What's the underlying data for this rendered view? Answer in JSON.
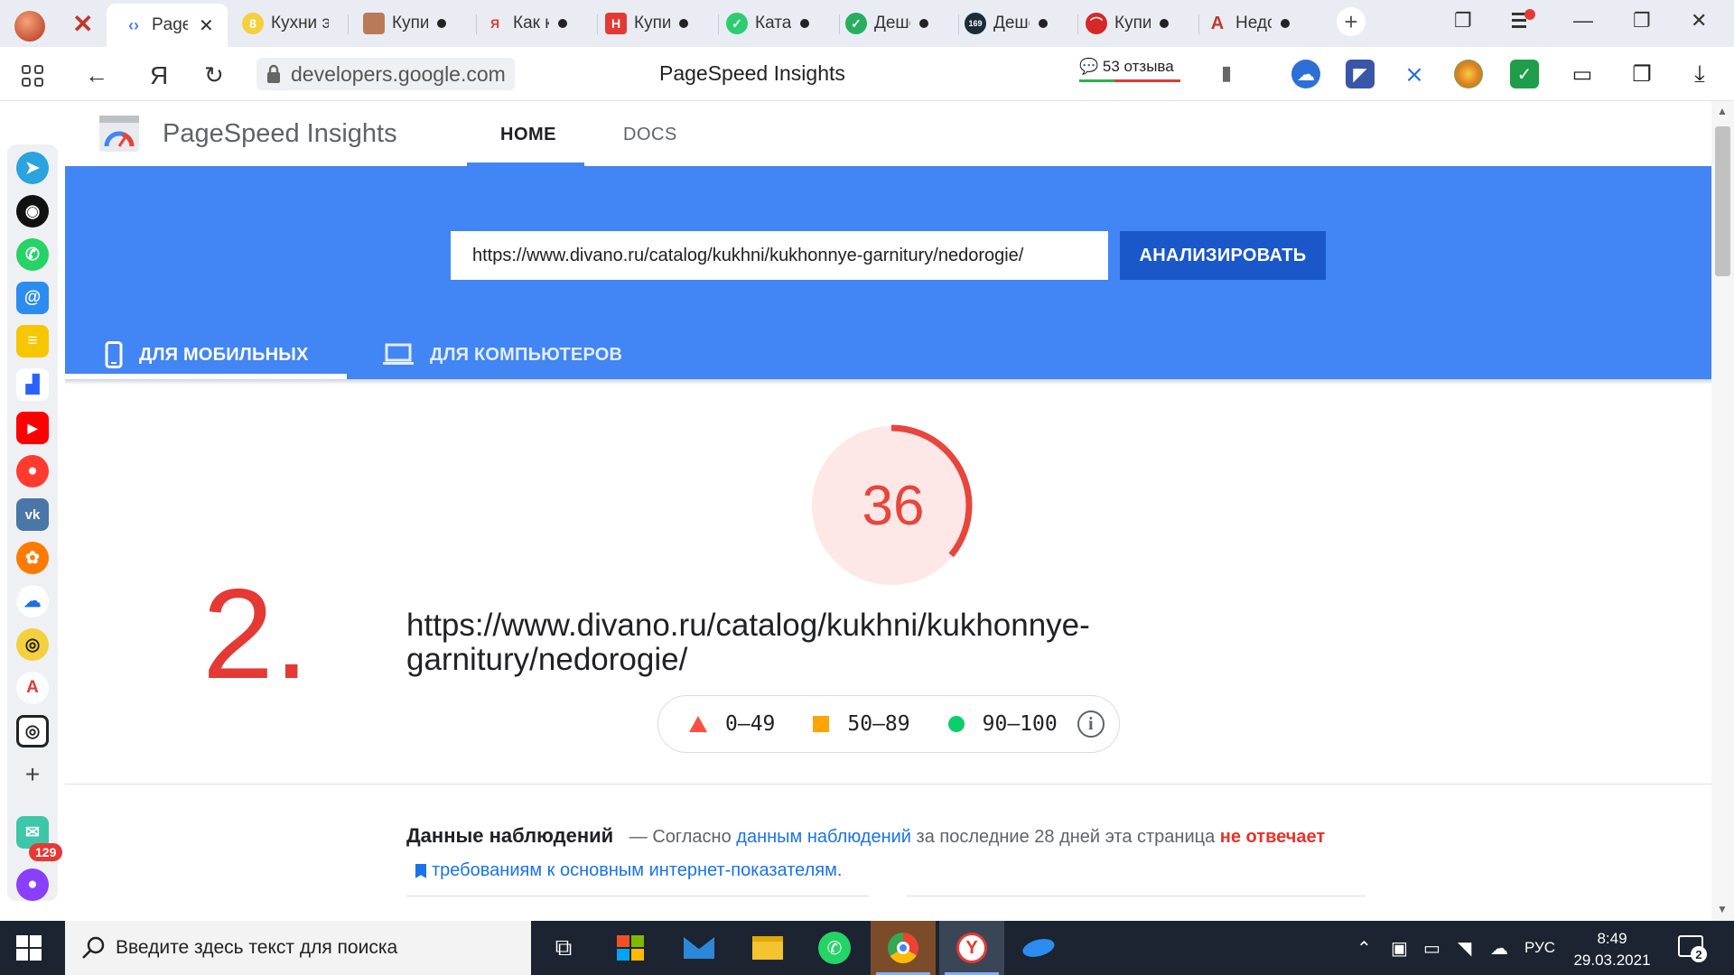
{
  "browser": {
    "tabs": [
      {
        "label": "Page",
        "active": true
      },
      {
        "label": "Кухни эконом",
        "active": false
      },
      {
        "label": "Купи",
        "active": false
      },
      {
        "label": "Как к",
        "active": false
      },
      {
        "label": "Купи",
        "active": false
      },
      {
        "label": "Ката",
        "active": false
      },
      {
        "label": "Деше",
        "active": false
      },
      {
        "label": "Деше",
        "active": false
      },
      {
        "label": "Купи",
        "active": false
      },
      {
        "label": "Недо",
        "active": false
      }
    ],
    "address": "developers.google.com",
    "page_title": "PageSpeed Insights",
    "reviews": "53 отзыва",
    "yandex_letter": "Я"
  },
  "psi": {
    "brand": "PageSpeed Insights",
    "nav": {
      "home": "HOME",
      "docs": "DOCS"
    },
    "url_value": "https://www.divano.ru/catalog/kukhni/kukhonnye-garnitury/nedorogie/",
    "analyze_label": "АНАЛИЗИРОВАТЬ",
    "tab_mobile": "ДЛЯ МОБИЛЬНЫХ",
    "tab_desktop": "ДЛЯ КОМПЬЮТЕРОВ",
    "score": 36,
    "score_color": "#e8453c",
    "tested_url": "https://www.divano.ru/catalog/kukhni/kukhonnye-garnitury/nedorogie/",
    "legend": {
      "fail": "0–49",
      "average": "50–89",
      "pass": "90–100"
    },
    "field_data": {
      "title": "Данные наблюдений",
      "dash": "—",
      "text_1": "Согласно",
      "link_1": "данным наблюдений",
      "text_2": "за последние 28 дней эта страница",
      "bad": "не отвечает",
      "link_2": "требованиям к основным интернет-показателям",
      "end": "."
    }
  },
  "annotation": {
    "number": "2."
  },
  "sidebar": {
    "badge": "129"
  },
  "taskbar": {
    "search_placeholder": "Введите здесь текст для поиска",
    "lang": "РУС",
    "time": "8:49",
    "date": "29.03.2021",
    "notifications": "2"
  },
  "colors": {
    "accent": "#4285f4",
    "fail": "#ff4e42",
    "average": "#ffa400",
    "pass": "#0cce6b"
  }
}
